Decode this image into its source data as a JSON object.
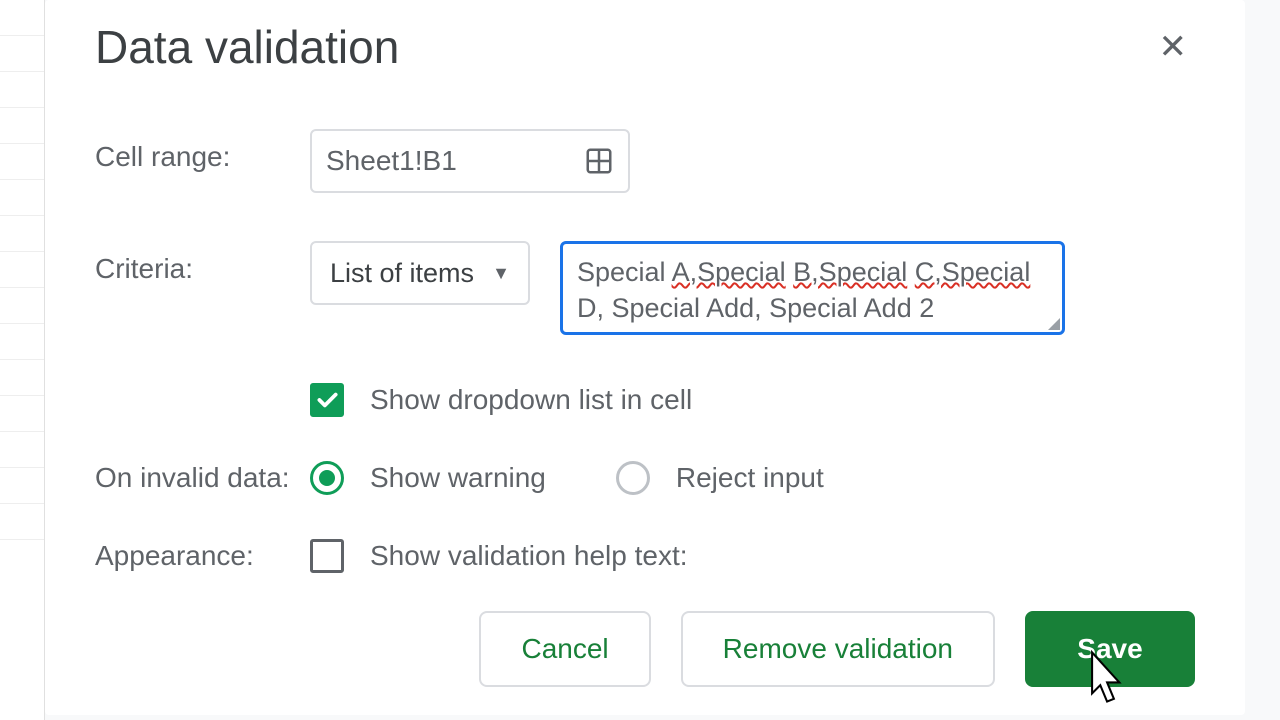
{
  "dialog": {
    "title": "Data validation",
    "labels": {
      "cell_range": "Cell range:",
      "criteria": "Criteria:",
      "on_invalid": "On invalid data:",
      "appearance": "Appearance:"
    },
    "cell_range_value": "Sheet1!B1",
    "criteria_type": "List of items",
    "criteria_items": "Special A,Special B,Special C,Special D, Special Add, Special Add 2",
    "show_dropdown": {
      "label": "Show dropdown list in cell",
      "checked": true
    },
    "invalid_options": {
      "warning": "Show warning",
      "reject": "Reject input",
      "selected": "warning"
    },
    "help_text": {
      "label": "Show validation help text:",
      "checked": false
    },
    "buttons": {
      "cancel": "Cancel",
      "remove": "Remove validation",
      "save": "Save"
    }
  }
}
